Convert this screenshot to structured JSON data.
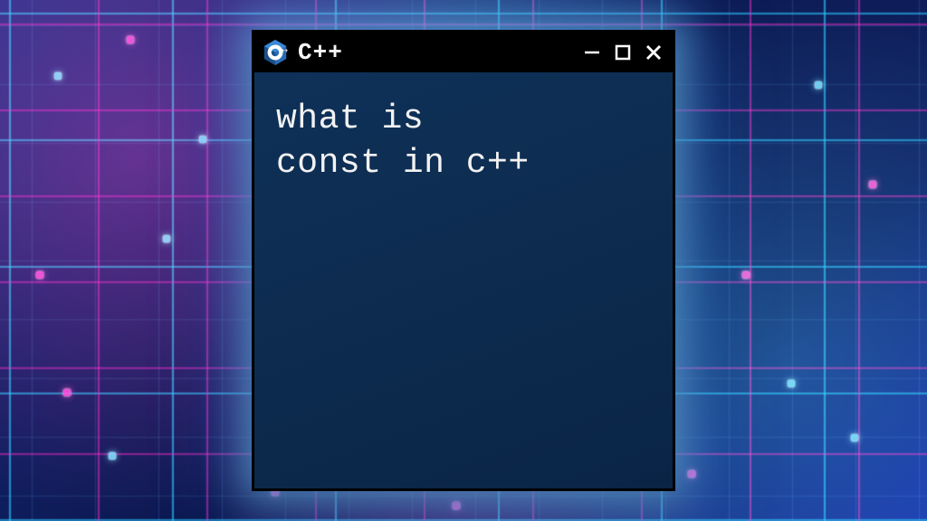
{
  "window": {
    "title": "C++",
    "icon_name": "cpp-icon",
    "content_text": "what is\nconst in c++"
  },
  "controls": {
    "minimize": "minimize",
    "maximize": "maximize",
    "close": "close"
  },
  "colors": {
    "window_bg": "#0e2e52",
    "titlebar_bg": "#000000",
    "text": "#f2f2f2",
    "glow": "#78c8ff"
  }
}
